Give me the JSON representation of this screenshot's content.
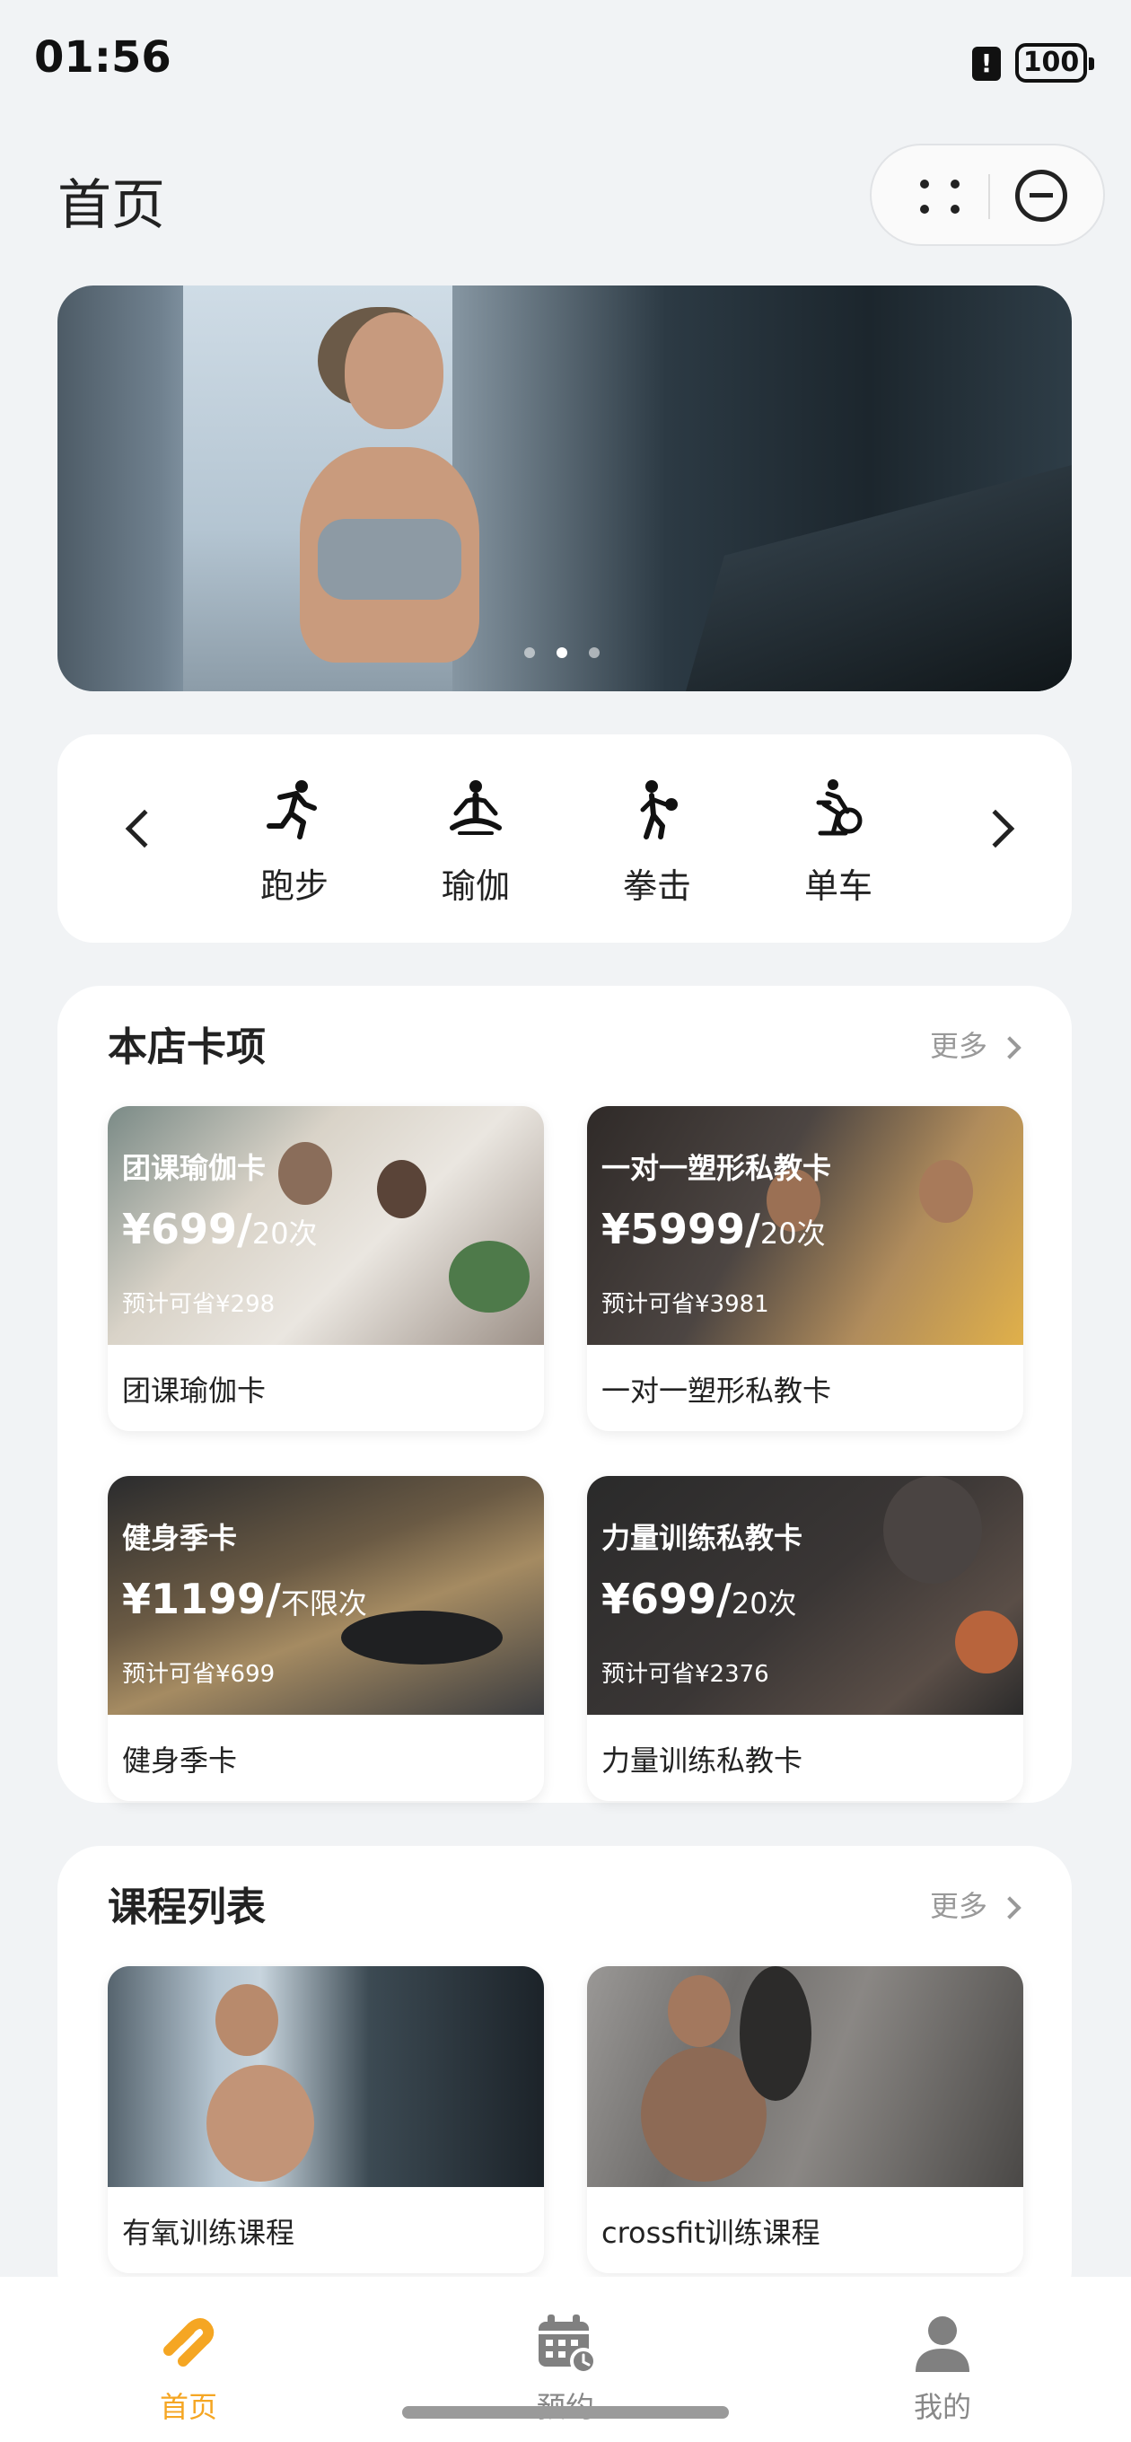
{
  "status_bar": {
    "time": "01:56",
    "battery": "100",
    "alert_glyph": "!"
  },
  "header": {
    "title": "首页"
  },
  "categories": {
    "items": [
      {
        "label": "跑步",
        "icon": "running-icon"
      },
      {
        "label": "瑜伽",
        "icon": "yoga-icon"
      },
      {
        "label": "拳击",
        "icon": "boxing-icon"
      },
      {
        "label": "单车",
        "icon": "cycling-icon"
      }
    ]
  },
  "cards_section": {
    "title": "本店卡项",
    "more": "更多",
    "items": [
      {
        "overlay_title": "团课瑜伽卡",
        "price": "¥699/",
        "unit": "20次",
        "save": "预计可省¥298",
        "name": "团课瑜伽卡"
      },
      {
        "overlay_title": "一对一塑形私教卡",
        "price": "¥5999/",
        "unit": "20次",
        "save": "预计可省¥3981",
        "name": "一对一塑形私教卡"
      },
      {
        "overlay_title": "健身季卡",
        "price": "¥1199/",
        "unit": "不限次",
        "save": "预计可省¥699",
        "name": "健身季卡"
      },
      {
        "overlay_title": "力量训练私教卡",
        "price": "¥699/",
        "unit": "20次",
        "save": "预计可省¥2376",
        "name": "力量训练私教卡"
      }
    ]
  },
  "courses_section": {
    "title": "课程列表",
    "more": "更多",
    "items": [
      {
        "name": "有氧训练课程"
      },
      {
        "name": "crossfit训练课程"
      }
    ]
  },
  "tabbar": {
    "items": [
      {
        "label": "首页",
        "active": true
      },
      {
        "label": "预约",
        "active": false
      },
      {
        "label": "我的",
        "active": false
      }
    ]
  },
  "colors": {
    "accent": "#f5a623",
    "background": "#f1f3f5"
  }
}
